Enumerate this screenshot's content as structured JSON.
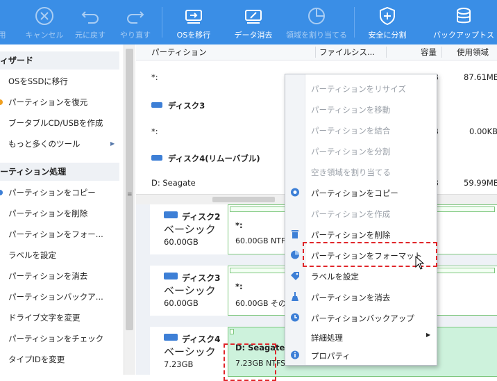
{
  "toolbar": {
    "items": [
      {
        "label": "用",
        "icon": "check-icon",
        "enabled": false
      },
      {
        "label": "キャンセル",
        "icon": "cancel-icon",
        "enabled": false
      },
      {
        "label": "元に戻す",
        "icon": "undo-icon",
        "enabled": false
      },
      {
        "label": "やり直す",
        "icon": "redo-icon",
        "enabled": false
      },
      {
        "label": "OSを移行",
        "icon": "migrate-os-icon",
        "enabled": true
      },
      {
        "label": "データ消去",
        "icon": "wipe-data-icon",
        "enabled": true
      },
      {
        "label": "領域を割り当てる",
        "icon": "allocate-space-icon",
        "enabled": false
      },
      {
        "label": "安全に分割",
        "icon": "shield-icon",
        "enabled": true
      },
      {
        "label": "バックアップトス",
        "icon": "backup-icon",
        "enabled": true
      }
    ]
  },
  "sidebar": {
    "wizard_header": "ィザード",
    "wizard_items": [
      {
        "label": "OSをSSDに移行",
        "icon": "ssd-icon"
      },
      {
        "label": "パーティションを復元",
        "icon": "recover-icon"
      },
      {
        "label": "ブータブルCD/USBを作成",
        "icon": "bootable-icon"
      },
      {
        "label": "もっと多くのツール",
        "icon": "tools-icon"
      }
    ],
    "ops_header": "ーティション処理",
    "ops_items": [
      {
        "label": "パーティションをコピー",
        "icon": "copy-icon"
      },
      {
        "label": "パーティションを削除",
        "icon": "delete-icon"
      },
      {
        "label": "パーティションをフォー...",
        "icon": "format-icon"
      },
      {
        "label": "ラベルを設定",
        "icon": "label-icon"
      },
      {
        "label": "パーティションを消去",
        "icon": "wipe-icon"
      },
      {
        "label": "パーティションバックア...",
        "icon": "backup-icon"
      },
      {
        "label": "ドライブ文字を変更",
        "icon": "drive-letter-icon"
      },
      {
        "label": "パーティションをチェック",
        "icon": "check-icon"
      },
      {
        "label": "タイプIDを変更",
        "icon": "type-id-icon"
      }
    ]
  },
  "table": {
    "columns": [
      "パーティション",
      "ファイルシス...",
      "容量",
      "使用領域"
    ],
    "rows": [
      {
        "kind": "partition",
        "name": "*:",
        "used": "87.61MB",
        "cap_tail": "B"
      },
      {
        "kind": "disk",
        "name": "ディスク3"
      },
      {
        "kind": "partition",
        "name": "*:",
        "used": "0.00KB",
        "cap_tail": "B"
      },
      {
        "kind": "disk",
        "name": "ディスク4(リムーバブル)"
      },
      {
        "kind": "partition",
        "name": "D: Seagate",
        "used": "59.99MB",
        "cap_tail": "B"
      }
    ]
  },
  "disk_cards": [
    {
      "name": "ディスク2",
      "type": "ベーシック",
      "size": "60.00GB",
      "part_name": "*:",
      "part_info": "60.00GB NTFS"
    },
    {
      "name": "ディスク3",
      "type": "ベーシック",
      "size": "60.00GB",
      "part_name": "*:",
      "part_info": "60.00GB その他"
    },
    {
      "name": "ディスク4",
      "type": "ベーシック",
      "size": "7.23GB",
      "part_name": "D: Seagate",
      "part_info": "7.23GB NTFS"
    }
  ],
  "context_menu": {
    "items": [
      {
        "label": "パーティションをリサイズ",
        "enabled": false,
        "icon": ""
      },
      {
        "label": "パーティションを移動",
        "enabled": false,
        "icon": ""
      },
      {
        "label": "パーティションを結合",
        "enabled": false,
        "icon": ""
      },
      {
        "label": "パーティションを分割",
        "enabled": false,
        "icon": ""
      },
      {
        "label": "空き領域を割り当てる",
        "enabled": false,
        "icon": ""
      },
      {
        "label": "パーティションをコピー",
        "enabled": true,
        "icon": "copy-icon"
      },
      {
        "label": "パーティションを作成",
        "enabled": false,
        "icon": ""
      },
      {
        "label": "パーティションを削除",
        "enabled": true,
        "icon": "trash-icon"
      },
      {
        "label": "パーティションをフォーマット",
        "enabled": true,
        "icon": "format-icon",
        "highlighted": true
      },
      {
        "label": "ラベルを設定",
        "enabled": true,
        "icon": "tag-icon"
      },
      {
        "label": "パーティションを消去",
        "enabled": true,
        "icon": "broom-icon"
      },
      {
        "label": "パーティションバックアップ",
        "enabled": true,
        "icon": "backup-icon"
      },
      {
        "label": "詳細処理",
        "enabled": true,
        "icon": "",
        "submenu": true
      },
      {
        "label": "プロパティ",
        "enabled": true,
        "icon": "info-icon"
      }
    ]
  },
  "colors": {
    "toolbar": "#3a8ee6",
    "accent": "#3d7fd6",
    "highlight": "#e0262a",
    "partition_green": "#7dc77d"
  }
}
